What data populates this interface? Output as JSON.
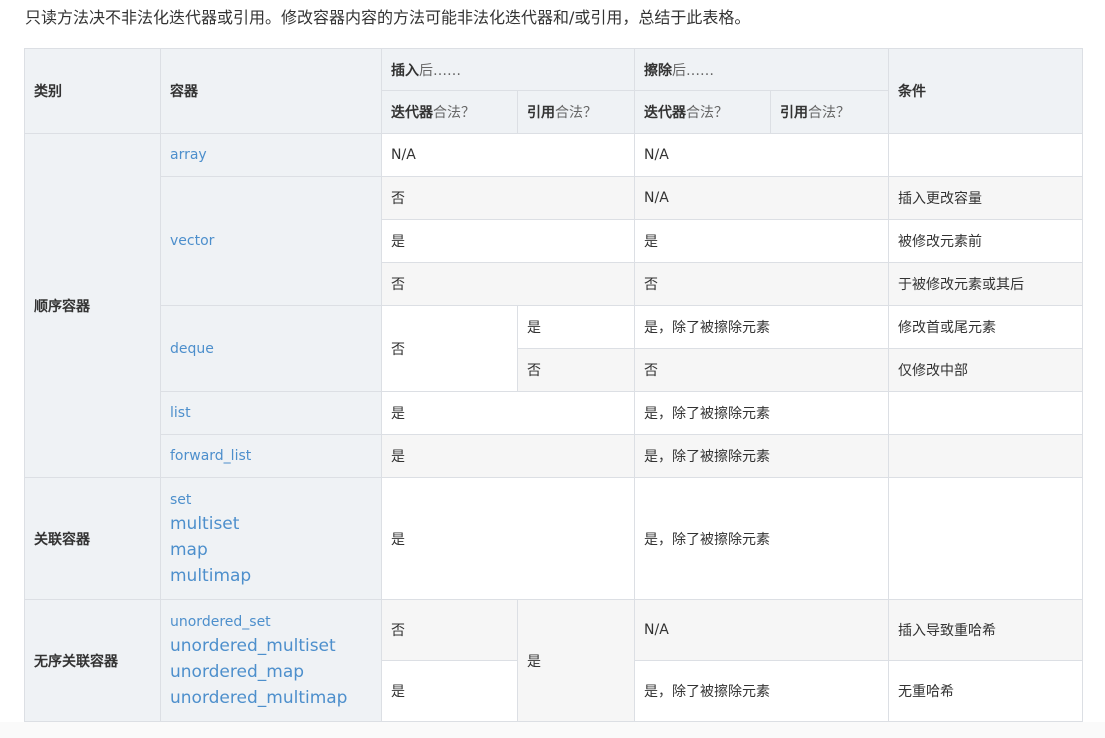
{
  "intro": "只读方法决不非法化迭代器或引用。修改容器内容的方法可能非法化迭代器和/或引用，总结于此表格。",
  "headers": {
    "category": "类别",
    "container": "容器",
    "insert_bold": "插入",
    "insert_rest": "后……",
    "erase_bold": "擦除",
    "erase_rest": "后……",
    "condition": "条件",
    "iter_bold": "迭代器",
    "iter_rest": "合法？",
    "ref_bold": "引用",
    "ref_rest": "合法？"
  },
  "categories": {
    "sequence": "顺序容器",
    "associative": "关联容器",
    "unordered": "无序关联容器"
  },
  "containers": {
    "array": "array",
    "vector": "vector",
    "deque": "deque",
    "list": "list",
    "forward_list": "forward_list",
    "set": "set",
    "multiset": "multiset",
    "map": "map",
    "multimap": "multimap",
    "unordered_set": "unordered_set",
    "unordered_multiset": "unordered_multiset",
    "unordered_map": "unordered_map",
    "unordered_multimap": "unordered_multimap"
  },
  "cells": {
    "array_insert": "N/A",
    "array_erase": "N/A",
    "vector_r1_insert": "否",
    "vector_r1_erase": "N/A",
    "vector_r1_cond": "插入更改容量",
    "vector_r2_insert": "是",
    "vector_r2_erase": "是",
    "vector_r2_cond": "被修改元素前",
    "vector_r3_insert": "否",
    "vector_r3_erase": "否",
    "vector_r3_cond": "于被修改元素或其后",
    "deque_insert_iter": "否",
    "deque_r1_ref": "是",
    "deque_r1_erase": "是，除了被擦除元素",
    "deque_r1_cond": "修改首或尾元素",
    "deque_r2_ref": "否",
    "deque_r2_erase": "否",
    "deque_r2_cond": "仅修改中部",
    "list_insert": "是",
    "list_erase": "是，除了被擦除元素",
    "fwd_insert": "是",
    "fwd_erase": "是，除了被擦除元素",
    "assoc_insert": "是",
    "assoc_erase": "是，除了被擦除元素",
    "unord_r1_iter": "否",
    "unord_ref": "是",
    "unord_r1_erase": "N/A",
    "unord_r1_cond": "插入导致重哈希",
    "unord_r2_iter": "是",
    "unord_r2_erase": "是，除了被擦除元素",
    "unord_r2_cond": "无重哈希"
  }
}
